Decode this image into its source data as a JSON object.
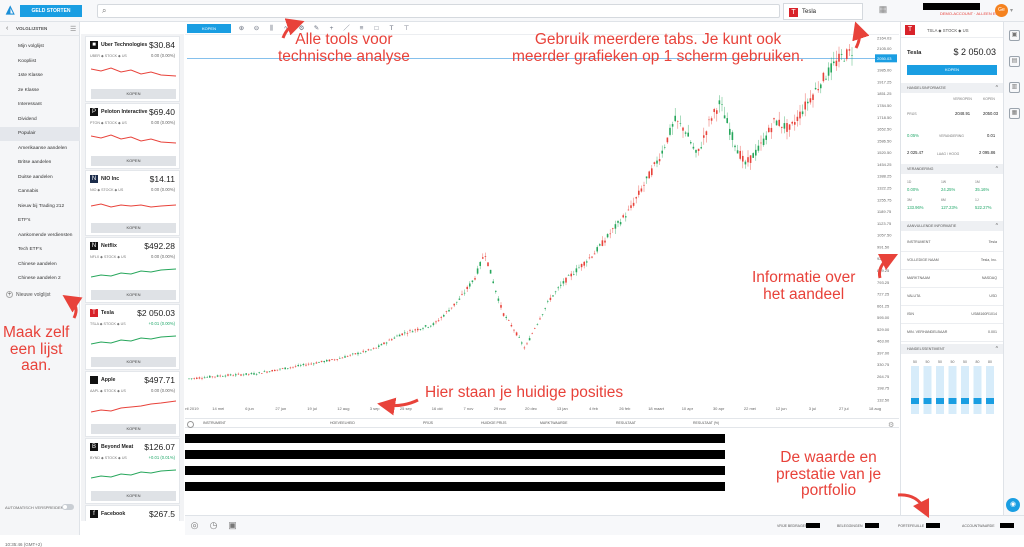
{
  "topbar": {
    "deposit_label": "GELD STORTEN",
    "tab_label": "Tesla",
    "tab_badge": "T",
    "account_sub": "DEMO-ACCOUNT · ALLEEN ECHT",
    "avatar": "Ge"
  },
  "sidebar": {
    "header": "VOLGLIJSTEN",
    "items": [
      "Mijn volglijst",
      "Koopliist",
      "1ste Klasse",
      "2e Klasse",
      "Interessant",
      "Dividend",
      "Populair",
      "Amerikaanse aandelen",
      "Britse aandelen",
      "Duitse aandelen",
      "Cannabis",
      "Nieuw bij Trading 212",
      "ETF's",
      "Aankomende verdiensten",
      "Tech ETF's",
      "Chinese aandelen",
      "Chinese aandelen 2"
    ],
    "active_index": 6,
    "new_list": "Nieuwe volglijst",
    "auto_label": "AUTOMATISCH VERSPREIDEN",
    "clock": "10:35:46 (GMT+2)"
  },
  "watchlist": [
    {
      "name": "Uber Technologies",
      "price": "$30.84",
      "sub": "UBER ◆ STOCK ◆ US",
      "change": "0.00 (0.00%)",
      "pos": false,
      "icon": "■",
      "icon_color": "#111",
      "trend": "down",
      "buy": "KOPEN"
    },
    {
      "name": "Peloton Interactive",
      "price": "$69.40",
      "sub": "PTON ◆ STOCK ◆ US",
      "change": "0.00 (0.00%)",
      "pos": false,
      "icon": "P",
      "icon_color": "#111",
      "trend": "down",
      "buy": "KOPEN"
    },
    {
      "name": "NIO Inc",
      "price": "$14.11",
      "sub": "NIO ◆ STOCK ◆ US",
      "change": "0.00 (0.00%)",
      "pos": false,
      "icon": "N",
      "icon_color": "#1a2b4a",
      "trend": "flat",
      "buy": "KOPEN"
    },
    {
      "name": "Netflix",
      "price": "$492.28",
      "sub": "NFLX ◆ STOCK ◆ US",
      "change": "0.00 (0.00%)",
      "pos": false,
      "icon": "N",
      "icon_color": "#111",
      "trend": "upg",
      "buy": "KOPEN"
    },
    {
      "name": "Tesla",
      "price": "$2 050.03",
      "sub": "TSLA ◆ STOCK ◆ US",
      "change": "+0.01 (0.00%)",
      "pos": true,
      "icon": "T",
      "icon_color": "#d8232a",
      "trend": "upg",
      "buy": "KOPEN"
    },
    {
      "name": "Apple",
      "price": "$497.71",
      "sub": "AAPL ◆ STOCK ◆ US",
      "change": "0.00 (0.00%)",
      "pos": false,
      "icon": "",
      "icon_color": "#111",
      "trend": "up",
      "buy": "KOPEN"
    },
    {
      "name": "Beyond Meat",
      "price": "$126.07",
      "sub": "BYND ◆ STOCK ◆ US",
      "change": "+0.01 (0.01%)",
      "pos": true,
      "icon": "B",
      "icon_color": "#111",
      "trend": "upg",
      "buy": "KOPEN"
    },
    {
      "name": "Facebook",
      "price": "$267.5",
      "sub": "",
      "change": "",
      "pos": false,
      "icon": "f",
      "icon_color": "#111",
      "trend": "none",
      "buy": ""
    }
  ],
  "toolbar": {
    "buy_label": "KOPEN",
    "tools": [
      "zoom-in",
      "zoom-out",
      "candles",
      "indicators",
      "settings",
      "drawing",
      "crosshair",
      "line",
      "fib",
      "rect",
      "text",
      "measure"
    ]
  },
  "chart_data": {
    "type": "candlestick",
    "y_ticks": [
      "2164.03",
      "2105.00",
      "2045.00",
      "1985.00",
      "1917.25",
      "1851.25",
      "1784.50",
      "1718.50",
      "1652.50",
      "1586.50",
      "1520.50",
      "1454.25",
      "1388.25",
      "1322.25",
      "1255.75",
      "1189.75",
      "1123.75",
      "1057.50",
      "991.50",
      "925.50",
      "859.25",
      "793.25",
      "727.25",
      "661.25",
      "595.00",
      "529.00",
      "463.00",
      "397.00",
      "330.75",
      "264.75",
      "198.75",
      "132.50"
    ],
    "x_ticks": [
      "22 april 2019",
      "14 mei",
      "6 jun",
      "27 jun",
      "19 jul",
      "12 aug",
      "3 sep",
      "25 sep",
      "16 okt",
      "7 nov",
      "29 nov",
      "20 dec",
      "13 jan",
      "4 feb",
      "26 feb",
      "18 maart",
      "10 apr",
      "30 apr",
      "22 mei",
      "12 jun",
      "3 jul",
      "27 jul",
      "18 aug"
    ],
    "last_price": "2050.03",
    "up_color": "#26a65b",
    "down_color": "#e8423a"
  },
  "positions": {
    "headers": [
      "INSTRUMENT",
      "HOEVEELHEID",
      "PRIJS",
      "HUIDIGE PRIJS",
      "MARKTWAARDE",
      "RESULTAAT",
      "RESULTAAT (%)"
    ]
  },
  "bottombar": {
    "labels": [
      "VRIJE BEDRAGEN",
      "BELEGGINGEN",
      "PORTEFEUILLE",
      "ACCOUNTWAARDE"
    ]
  },
  "right_panel": {
    "badge": "T",
    "subtitle": "TSLA ◆ STOCK ◆ US",
    "title": "Tesla",
    "price": "$ 2 050.03",
    "buy": "KOPEN",
    "sections": [
      "HANDELSINFORMATIE",
      "VERANDERING",
      "AANVULLENDE INFORMATIE",
      "HANDELSSENTIMENT"
    ],
    "trade_hdr": [
      "VERKOPEN",
      "KOPEN"
    ],
    "trade_row_label": "PRIJS",
    "trade_vals": [
      "2048.91",
      "2050.03"
    ],
    "spread_pct": "0.05%",
    "spread_label": "VERANDERING",
    "spread_val": "0.01",
    "low_high": [
      "2 025.47",
      "LAAG / HOOG",
      "2 095.86"
    ],
    "chg_labels": [
      "1D",
      "1W",
      "1M",
      "3M",
      "6M",
      "1J"
    ],
    "chg_vals": [
      "0.00%",
      "24.25%",
      "35.16%",
      "133.96%",
      "127.23%",
      "522.27%"
    ],
    "info_labels": [
      "INSTRUMENT",
      "VOLLEDIGE NAAM",
      "MARKTNAAM",
      "VALUTA",
      "ISIN",
      "MIN. VERHANDELBAAR"
    ],
    "info_vals": [
      "Tesla",
      "Tesla, Inc.",
      "NASDAQ",
      "USD",
      "US88160R1014",
      "0.001"
    ],
    "sentiment_cols": [
      "50",
      "50",
      "50",
      "50",
      "50",
      "80",
      "80"
    ]
  },
  "annotations": {
    "tools": "Alle tools voor\ntechnische analyse",
    "tabs": "Gebruik meerdere tabs. Je kunt ook\nmeerder grafieken op 1 scherm gebruiken.",
    "info": "Informatie over\nhet aandeel",
    "positions": "Hier staan je huidige posities",
    "list": "Maak zelf\neen lijst\naan.",
    "value": "De waarde en\nprestatie van je\nportfolio"
  }
}
